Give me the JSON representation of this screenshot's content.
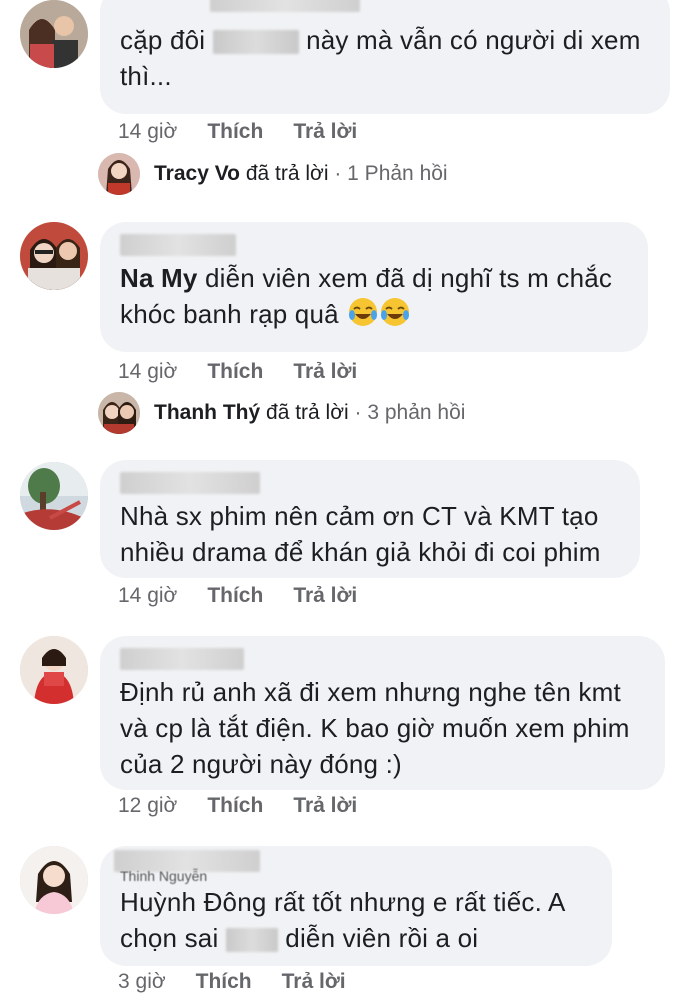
{
  "comments": [
    {
      "text_parts": [
        "cặp đôi ",
        " này mà vẫn có người di xem",
        "thì..."
      ],
      "time": "14 giờ",
      "like": "Thích",
      "reply": "Trả lời"
    },
    {
      "mention": "Na My",
      "text_parts": [
        " diễn viên xem đã dị nghĩ ts m chắc",
        "khóc banh rạp quâ "
      ],
      "emojis": [
        "laughing-crying",
        "laughing-crying"
      ],
      "time": "14 giờ",
      "like": "Thích",
      "reply": "Trả lời"
    },
    {
      "text_parts": [
        "Nhà sx phim nên cảm ơn CT và KMT tạo",
        "nhiều drama để khán giả khỏi đi coi phim"
      ],
      "time": "14 giờ",
      "like": "Thích",
      "reply": "Trả lời"
    },
    {
      "text_parts": [
        "Định rủ anh xã đi xem nhưng nghe tên kmt",
        "và cp là tắt điện. K bao giờ muốn xem phim",
        "của 2 người này đóng :)"
      ],
      "time": "12 giờ",
      "like": "Thích",
      "reply": "Trả lời"
    },
    {
      "text_parts": [
        "Huỳnh Đông rất tốt nhưng e rất tiếc.  A",
        "chọn sai ",
        " diễn viên rồi a oi"
      ],
      "time": "3 giờ",
      "like": "Thích",
      "reply": "Trả lời"
    }
  ],
  "replies": [
    {
      "name": "Tracy Vo",
      "action": "đã trả lời",
      "sep": "·",
      "count": "1 Phản hồi"
    },
    {
      "name": "Thanh Thý",
      "action": "đã trả lời",
      "sep": "·",
      "count": "3 phản hồi"
    }
  ],
  "blurred_name_fragment": "Thinh Nguyễn",
  "colors": {
    "bubble": "#f0f2f5",
    "meta": "#65676b",
    "text": "#1c1e21"
  }
}
